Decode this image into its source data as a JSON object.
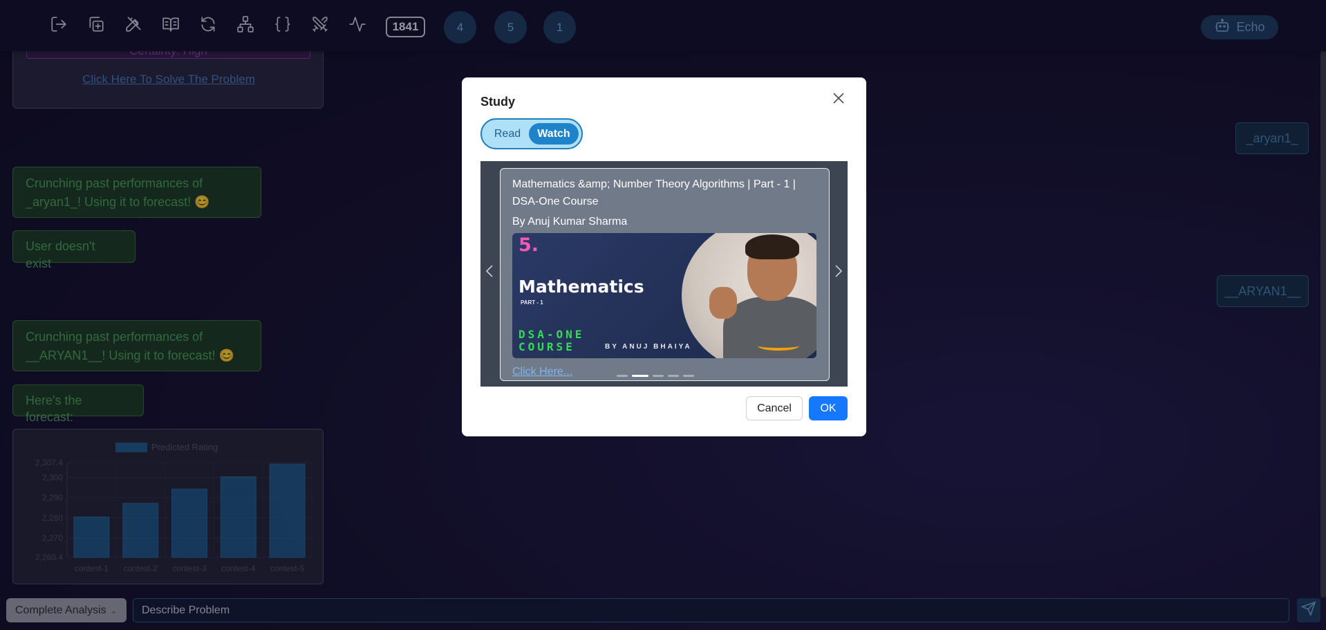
{
  "toolbar": {
    "icons": [
      "logout-icon",
      "copy-plus-icon",
      "pencil-ruler-icon",
      "book-open-icon",
      "refresh-icon",
      "sitemap-icon",
      "braces-icon",
      "swords-icon",
      "activity-icon"
    ],
    "rating": "1841",
    "badges": [
      "4",
      "5",
      "1"
    ],
    "echo_label": "Echo"
  },
  "chat": {
    "certainty": "Certainty: High",
    "solve_link": "Click Here To Solve The Problem",
    "messages": [
      "Crunching past performances of _aryan1_! Using it to forecast! 😊",
      "User doesn't exist",
      "Crunching past performances of __ARYAN1__! Using it to forecast! 😊",
      "Here's the forecast:"
    ],
    "user_tags": [
      "_aryan1_",
      "__ARYAN1__"
    ]
  },
  "chart_data": {
    "type": "bar",
    "title": "",
    "legend": "Predicted Rating",
    "categories": [
      "contest-1",
      "contest-2",
      "contest-3",
      "contest-4",
      "contest-5"
    ],
    "values": [
      2280.5,
      2287.3,
      2294.3,
      2300.4,
      2306.7
    ],
    "ytick_labels": [
      "2,307.4",
      "2,300",
      "2,290",
      "2,280",
      "2,270",
      "2,260.4"
    ],
    "ylim": [
      2260.4,
      2307.4
    ],
    "color": "#1f6fa8"
  },
  "bottom": {
    "select_value": "Complete Analysis",
    "input_placeholder": "Describe Problem"
  },
  "modal": {
    "title": "Study",
    "toggle_read": "Read",
    "toggle_watch": "Watch",
    "video_title": "Mathematics &amp; Number Theory Algorithms | Part - 1 | DSA-One Course",
    "author": "By Anuj Kumar Sharma",
    "thumbnail": {
      "number": "5.",
      "heading": "Mathematics",
      "part": "PART - 1",
      "course_line1": "DSA-ONE",
      "course_line2": "COURSE",
      "byline": "BY ANUJ BHAIYA"
    },
    "link": "Click Here...",
    "slide_count": 5,
    "active_slide": 1,
    "cancel_label": "Cancel",
    "ok_label": "OK"
  }
}
